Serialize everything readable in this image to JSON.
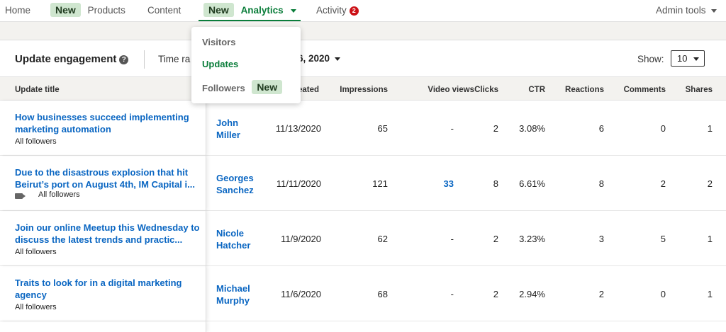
{
  "nav": {
    "home": "Home",
    "products_badge": "New",
    "products": "Products",
    "content": "Content",
    "analytics_badge": "New",
    "analytics": "Analytics",
    "activity": "Activity",
    "activity_count": "2",
    "admin_tools": "Admin tools"
  },
  "dropdown": {
    "items": [
      {
        "label": "Visitors"
      },
      {
        "label": "Updates",
        "active": true
      },
      {
        "label": "Followers",
        "badge": "New"
      }
    ]
  },
  "section": {
    "title": "Update engagement",
    "time_range_label": "Time ra",
    "date_text": "6, 2020",
    "show_label": "Show:",
    "show_value": "10"
  },
  "table": {
    "columns": [
      "Update title",
      "eated",
      "Impressions",
      "Video views",
      "Clicks",
      "CTR",
      "Reactions",
      "Comments",
      "Shares"
    ],
    "rows": [
      {
        "title": "How businesses succeed implementing marketing automation",
        "audience": "All followers",
        "creator": "John Miller",
        "created": "11/13/2020",
        "impressions": "65",
        "video_views": "-",
        "clicks": "2",
        "ctr": "3.08%",
        "reactions": "6",
        "comments": "0",
        "shares": "1"
      },
      {
        "title": "Due to the disastrous explosion that hit Beirut’s port on August 4th, IM Capital i...",
        "audience": "All followers",
        "creator": "Georges Sanchez",
        "created": "11/11/2020",
        "impressions": "121",
        "video_views": "33",
        "clicks": "8",
        "ctr": "6.61%",
        "reactions": "8",
        "comments": "2",
        "shares": "2"
      },
      {
        "title": "Join our online Meetup this Wednesday to discuss the latest trends and practic...",
        "audience": "All followers",
        "creator": "Nicole Hatcher",
        "created": "11/9/2020",
        "impressions": "62",
        "video_views": "-",
        "clicks": "2",
        "ctr": "3.23%",
        "reactions": "3",
        "comments": "5",
        "shares": "1"
      },
      {
        "title": "Traits to look for in a digital marketing agency",
        "audience": "All followers",
        "creator": "Michael Murphy",
        "created": "11/6/2020",
        "impressions": "68",
        "video_views": "-",
        "clicks": "2",
        "ctr": "2.94%",
        "reactions": "2",
        "comments": "0",
        "shares": "1"
      }
    ]
  },
  "colors": {
    "accent_green": "#0a7d3a",
    "link_blue": "#0a66c2",
    "badge_bg": "#cfe6cf",
    "notif_red": "#cc1016"
  }
}
